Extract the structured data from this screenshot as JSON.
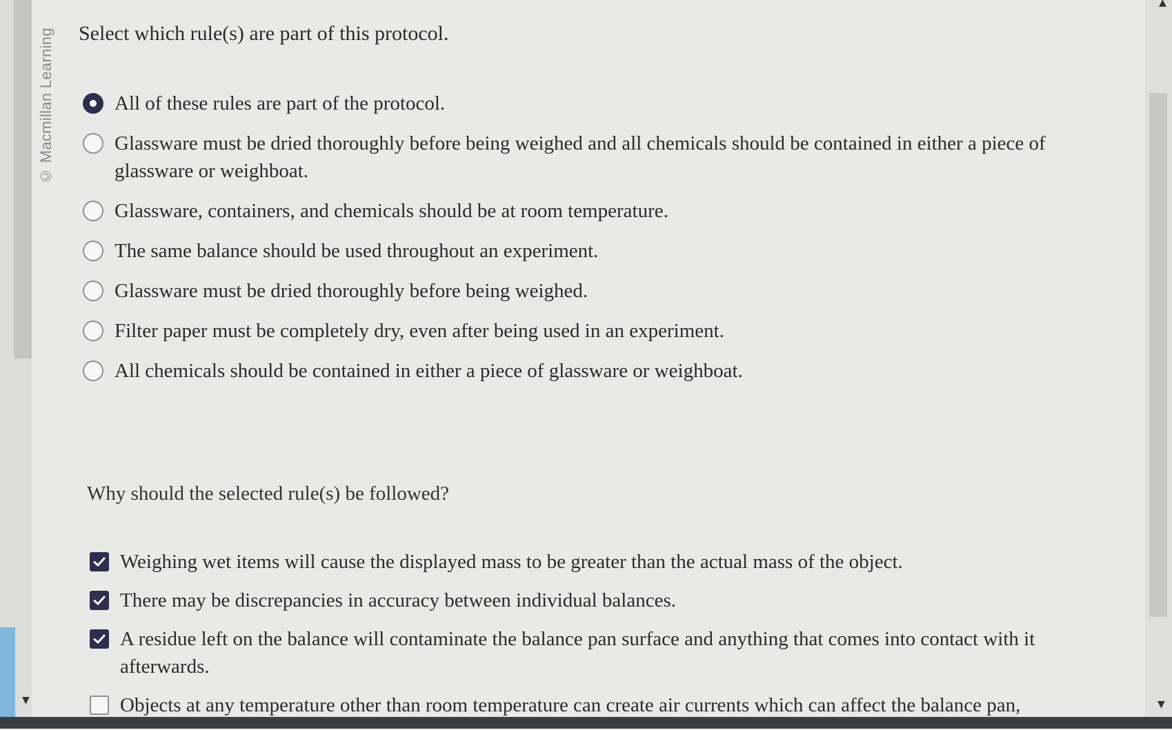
{
  "credit": "© Macmillan Learning",
  "question1": {
    "prompt": "Select which rule(s) are part of this protocol.",
    "options": [
      {
        "label": "All of these rules are part of the protocol.",
        "selected": true
      },
      {
        "label": "Glassware must be dried thoroughly before being weighed and all chemicals should be contained in either a piece of glassware or weighboat.",
        "selected": false
      },
      {
        "label": "Glassware, containers, and chemicals should be at room temperature.",
        "selected": false
      },
      {
        "label": "The same balance should be used throughout an experiment.",
        "selected": false
      },
      {
        "label": "Glassware must be dried thoroughly before being weighed.",
        "selected": false
      },
      {
        "label": "Filter paper must be completely dry, even after being used in an experiment.",
        "selected": false
      },
      {
        "label": "All chemicals should be contained in either a piece of glassware or weighboat.",
        "selected": false
      }
    ]
  },
  "question2": {
    "prompt": "Why should the selected rule(s) be followed?",
    "options": [
      {
        "label": "Weighing wet items will cause the displayed mass to be greater than the actual mass of the object.",
        "checked": true
      },
      {
        "label": "There may be discrepancies in accuracy between individual balances.",
        "checked": true
      },
      {
        "label": "A residue left on the balance will contaminate the balance pan surface and anything that comes into contact with it afterwards.",
        "checked": true
      },
      {
        "label": "Objects at any temperature other than room temperature can create air currents which can affect the balance pan,",
        "checked": false
      }
    ]
  },
  "colors": {
    "accent": "#2f2e4f",
    "background": "#e9e9e8",
    "text": "#2b2b2b"
  },
  "icons": {
    "radio_selected": "radio-selected-icon",
    "checkbox_checked": "checkmark-icon"
  }
}
